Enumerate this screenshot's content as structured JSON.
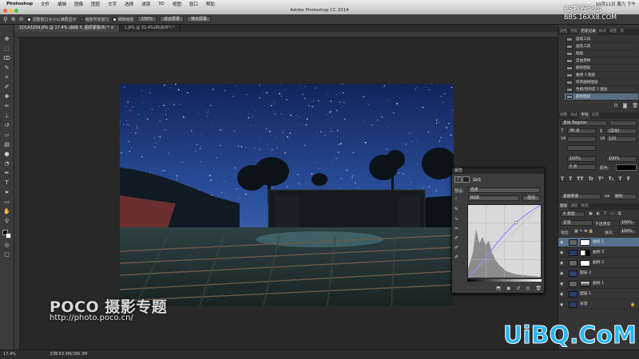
{
  "menubar": {
    "app": "Photoshop",
    "items": [
      "文件",
      "编辑",
      "图像",
      "图层",
      "文字",
      "选择",
      "滤镜",
      "3D",
      "视图",
      "窗口",
      "帮助"
    ],
    "clock": "10月11日 周六 下午"
  },
  "window": {
    "title": "Adobe Photoshop CC 2014"
  },
  "options": {
    "check1": "调整窗口大小以满屏显示",
    "check2": "缩放所有窗口",
    "check3": "细微缩放",
    "btn_100": "100%",
    "btn_fit": "适合屏幕",
    "btn_fill": "填充屏幕"
  },
  "tabs": [
    {
      "label": "1D1A3259.JPG @ 17.4% (曲线 3, 图层蒙版/8) * ×",
      "active": true
    },
    {
      "label": "1.JPG @ 32.4%(RGB/8*) *",
      "active": false
    }
  ],
  "status": {
    "zoom": "17.4%",
    "doc": "文档:63.9M/286.3M"
  },
  "properties": {
    "panel_label": "属性",
    "title": "曲线",
    "preset_label": "预设:",
    "preset_value": "自定",
    "channel": "RGB",
    "auto": "自动"
  },
  "dock": {
    "top_tabs": [
      "颜色",
      "色板",
      "历史记录",
      "样式",
      "调整",
      "库"
    ],
    "history": [
      "画笔工具",
      "画笔工具",
      "粘贴",
      "自由变换",
      "删除图层",
      "曲线 3 图层",
      "修改曲线图层",
      "色相/饱和度 1 图层",
      "删除图层"
    ],
    "char_tabs": [
      "调整",
      "样式",
      "字符",
      "段落"
    ],
    "font_family": "黑体",
    "font_style": "Regular",
    "font_size": "36 点",
    "leading": "(自动)",
    "tracking": "120",
    "scale_v": "100%",
    "scale_h": "100%",
    "baseline": "0 点",
    "color_label": "颜色:",
    "lang": "美国英语",
    "aa": "锐利",
    "layer_tabs": [
      "图层",
      "通道",
      "路径"
    ],
    "layer_filter": "类型",
    "blend_mode": "正常",
    "opacity_label": "不透明度:",
    "opacity": "100%",
    "lock_label": "锁定:",
    "fill_label": "填充:",
    "fill": "100%",
    "layers": [
      {
        "name": "曲线 1",
        "selected": true
      },
      {
        "name": "曲线 3",
        "selected": false
      },
      {
        "name": "曲线 2",
        "selected": false
      },
      {
        "name": "图层 2",
        "selected": false
      },
      {
        "name": "曲线 1",
        "selected": false
      },
      {
        "name": "图层 1",
        "selected": false
      },
      {
        "name": "背景",
        "selected": false
      }
    ]
  },
  "watermarks": {
    "poco": "POCO 摄影专题",
    "poco_url": "http://photo.poco.cn/",
    "ps_name": "PS教程论坛",
    "ps_url": "BBS.16XX8.COM",
    "uibq": "UiBQ.CoM"
  },
  "colors": {
    "accent": "#27b6f4",
    "selection": "#58708d",
    "curve": "#8c8cff"
  }
}
